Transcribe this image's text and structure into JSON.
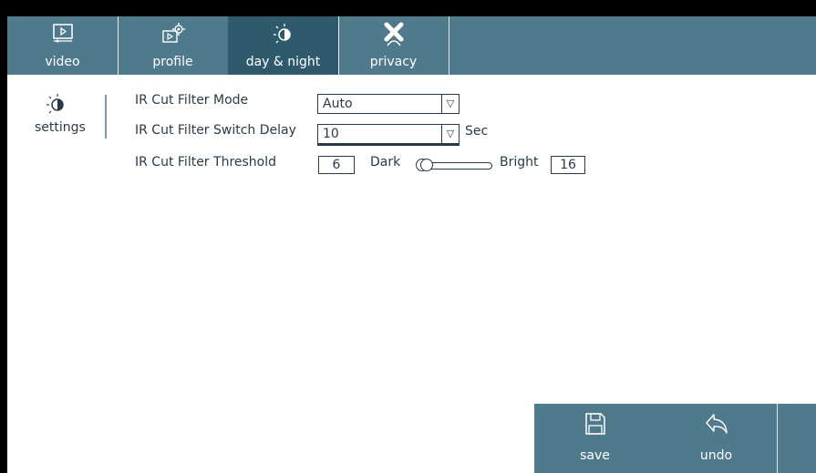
{
  "tabs": [
    {
      "label": "video",
      "icon": "video-icon"
    },
    {
      "label": "profile",
      "icon": "profile-gear-icon"
    },
    {
      "label": "day & night",
      "icon": "day-night-icon",
      "active": true
    },
    {
      "label": "privacy",
      "icon": "privacy-mask-icon"
    }
  ],
  "sidebar": {
    "label": "settings",
    "icon": "day-night-icon"
  },
  "settings": {
    "mode_label": "IR Cut Filter Mode",
    "mode_value": "Auto",
    "delay_label": "IR Cut Filter Switch Delay",
    "delay_value": "10",
    "delay_unit": "Sec",
    "threshold_label": "IR Cut Filter Threshold",
    "threshold_value": "6",
    "dark_label": "Dark",
    "bright_label": "Bright",
    "bright_value": "16"
  },
  "actions": {
    "save_label": "save",
    "undo_label": "undo"
  },
  "colors": {
    "bar": "#4f7a8c",
    "active_tab": "#2e5a6b",
    "text": "#2b3a48"
  }
}
